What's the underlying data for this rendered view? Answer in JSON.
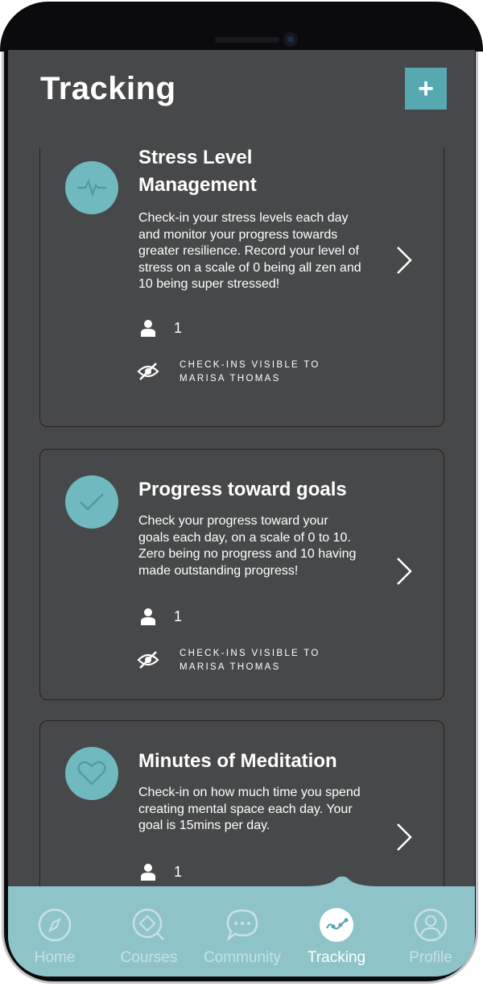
{
  "header": {
    "title": "Tracking",
    "add_label": "+"
  },
  "cards": [
    {
      "title": "Stress Level Management",
      "description": "Check-in your stress levels each day and monitor your progress towards greater resilience. Record your level of stress on a scale of 0 being all zen and 10 being super stressed!",
      "participants": "1",
      "visibility_line1": "CHECK-INS VISIBLE TO",
      "visibility_line2": "MARISA THOMAS",
      "icon": "heartbeat-icon"
    },
    {
      "title": "Progress toward goals",
      "description": "Check your progress toward your goals each day, on a scale of 0 to 10. Zero being no progress and 10 having made outstanding progress!",
      "participants": "1",
      "visibility_line1": "CHECK-INS VISIBLE TO",
      "visibility_line2": "MARISA THOMAS",
      "icon": "checkmark-icon"
    },
    {
      "title": "Minutes of Meditation",
      "description": "Check-in on how much time you spend creating mental space each day. Your goal is 15mins per day.",
      "participants": "1",
      "icon": "heart-icon"
    }
  ],
  "nav": {
    "items": [
      {
        "label": "Home",
        "icon": "compass-icon"
      },
      {
        "label": "Courses",
        "icon": "courses-icon"
      },
      {
        "label": "Community",
        "icon": "chat-icon"
      },
      {
        "label": "Tracking",
        "icon": "tracking-icon",
        "active": true
      },
      {
        "label": "Profile",
        "icon": "user-icon"
      }
    ]
  },
  "colors": {
    "accent": "#56a9b0",
    "screen": "#474849",
    "nav": "#8ec4c8"
  }
}
